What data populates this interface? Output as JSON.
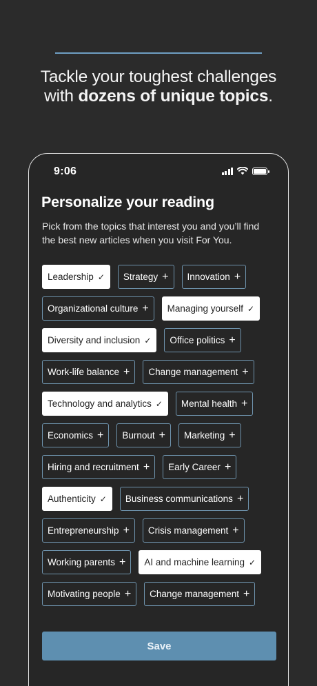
{
  "header": {
    "line1": "Tackle your toughest challenges",
    "line2_prefix": "with ",
    "line2_bold": "dozens of unique topics",
    "line2_suffix": "."
  },
  "status_bar": {
    "time": "9:06"
  },
  "screen": {
    "title": "Personalize your reading",
    "subtitle": "Pick from the topics that interest you and you’ll find the best new articles when you visit For You."
  },
  "topics": [
    {
      "label": "Leadership",
      "selected": true
    },
    {
      "label": "Strategy",
      "selected": false
    },
    {
      "label": "Innovation",
      "selected": false
    },
    {
      "label": "Organizational culture",
      "selected": false
    },
    {
      "label": "Managing yourself",
      "selected": true
    },
    {
      "label": "Diversity and inclusion",
      "selected": true
    },
    {
      "label": "Office politics",
      "selected": false
    },
    {
      "label": "Work-life balance",
      "selected": false
    },
    {
      "label": "Change management",
      "selected": false
    },
    {
      "label": "Technology and analytics",
      "selected": true
    },
    {
      "label": "Mental health",
      "selected": false
    },
    {
      "label": "Economics",
      "selected": false
    },
    {
      "label": "Burnout",
      "selected": false
    },
    {
      "label": "Marketing",
      "selected": false
    },
    {
      "label": "Hiring and recruitment",
      "selected": false
    },
    {
      "label": "Early Career",
      "selected": false
    },
    {
      "label": "Authenticity",
      "selected": true
    },
    {
      "label": "Business communications",
      "selected": false
    },
    {
      "label": "Entrepreneurship",
      "selected": false
    },
    {
      "label": "Crisis management",
      "selected": false
    },
    {
      "label": "Working parents",
      "selected": false
    },
    {
      "label": "AI and machine learning",
      "selected": true
    },
    {
      "label": "Motivating people",
      "selected": false
    },
    {
      "label": "Change management",
      "selected": false
    }
  ],
  "marks": {
    "selected": "✓",
    "unselected": "+"
  },
  "save_label": "Save",
  "colors": {
    "accent": "#6f9fc4",
    "button": "#5e8fb0",
    "background": "#2b2b2b"
  }
}
